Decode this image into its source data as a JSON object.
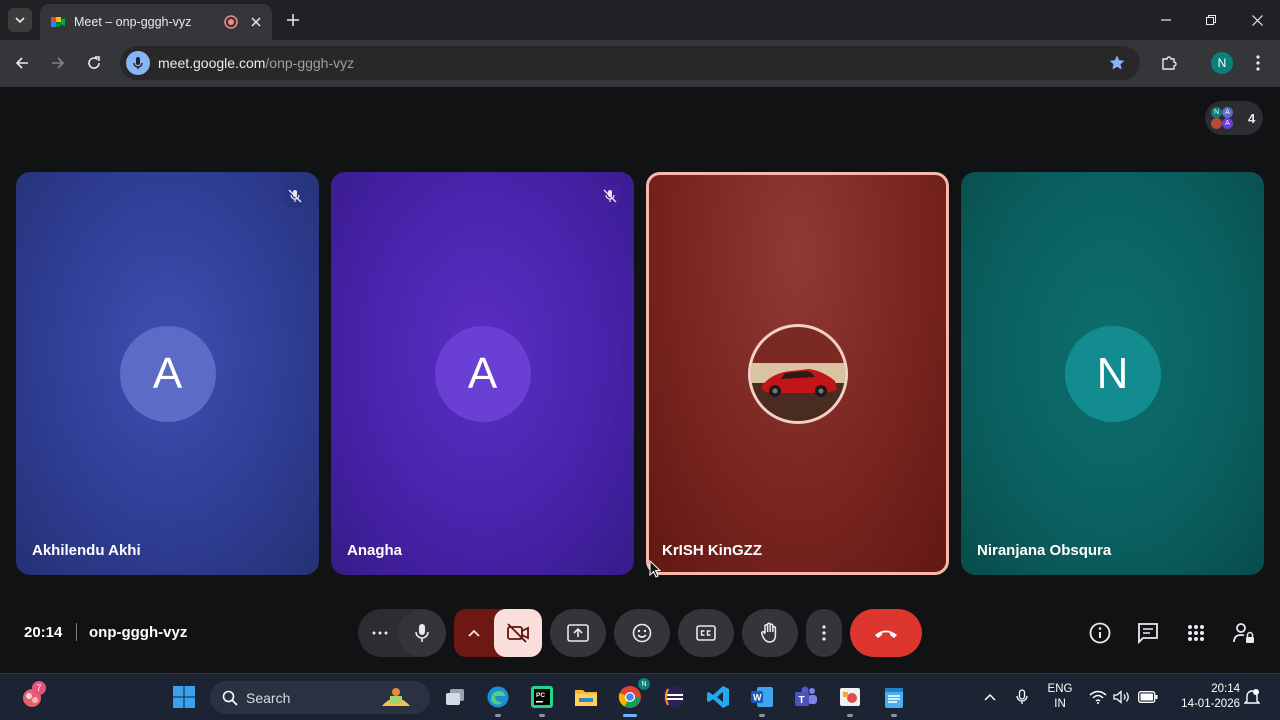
{
  "browser": {
    "tab_title": "Meet – onp-gggh-vyz",
    "url_host": "meet.google.com",
    "url_path": "/onp-gggh-vyz",
    "profile_initial": "N"
  },
  "meeting": {
    "time": "20:14",
    "code": "onp-gggh-vyz",
    "participant_count": "4",
    "chip_initials": [
      "N",
      "A",
      "A"
    ]
  },
  "participants": [
    {
      "name": "Akhilendu Akhi",
      "initial": "A",
      "muted": true
    },
    {
      "name": "Anagha",
      "initial": "A",
      "muted": true
    },
    {
      "name": "KrISH KinGZZ",
      "initial": "",
      "speaking": true
    },
    {
      "name": "Niranjana Obsqura",
      "initial": "N",
      "muted": false
    }
  ],
  "taskbar": {
    "search_label": "Search",
    "widget_badge": "7",
    "lang_line1": "ENG",
    "lang_line2": "IN",
    "time": "20:14",
    "date": "14-01-2026"
  },
  "colors": {
    "end_call": "#dc362e",
    "cam_off_bg": "#f9dedc",
    "speaking_border": "#f7b7ad"
  }
}
